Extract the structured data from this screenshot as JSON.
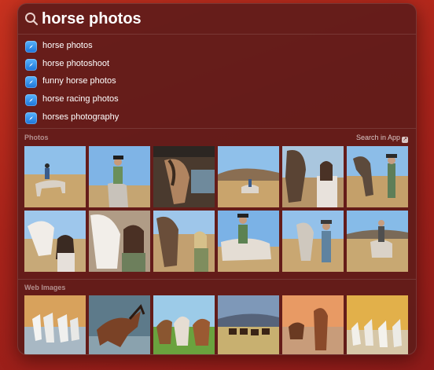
{
  "search": {
    "query": "horse photos"
  },
  "suggestions": [
    {
      "label": "horse photos"
    },
    {
      "label": "horse photoshoot"
    },
    {
      "label": "funny horse photos"
    },
    {
      "label": "horse racing photos"
    },
    {
      "label": "horses photography"
    }
  ],
  "photos_section": {
    "title": "Photos",
    "search_in_app": "Search in App"
  },
  "web_section": {
    "title": "Web Images"
  },
  "colors": {
    "background": "#b0281c",
    "panel": "#601c1a",
    "accent": "#1c74d9"
  }
}
